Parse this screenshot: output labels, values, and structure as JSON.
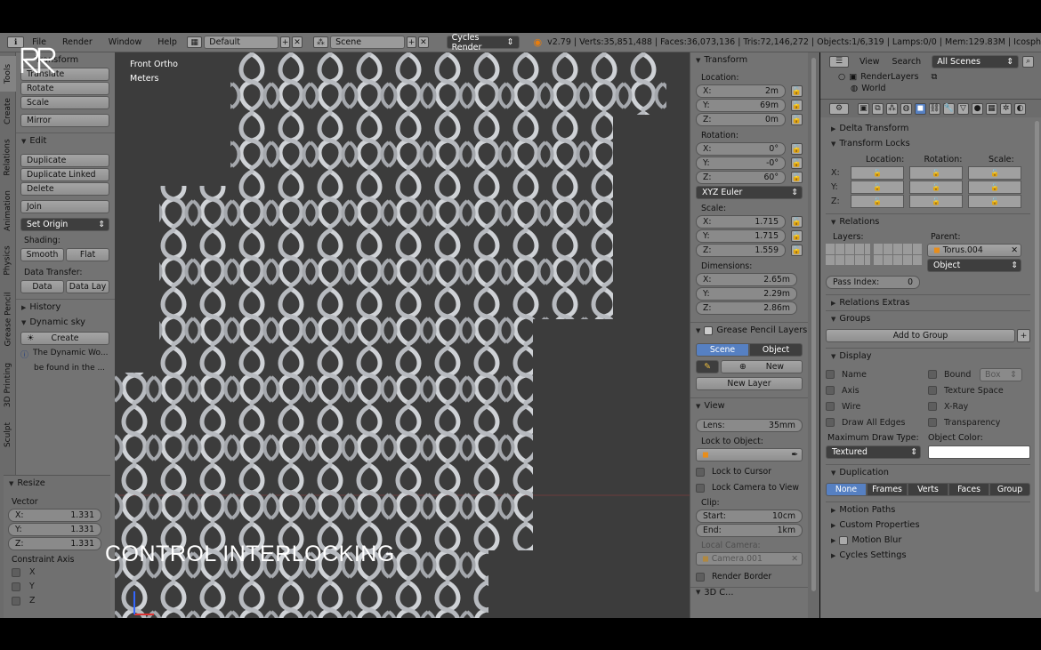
{
  "menu": {
    "file": "File",
    "render": "Render",
    "window": "Window",
    "help": "Help",
    "layout": "Default",
    "scene": "Scene",
    "engine": "Cycles Render"
  },
  "stats": "v2.79 | Verts:35,851,488 | Faces:36,073,136 | Tris:72,146,272 | Objects:1/6,319 | Lamps:0/0 | Mem:129.83M | Icosph",
  "tabs": [
    "Tools",
    "Create",
    "Relations",
    "Animation",
    "Physics",
    "Grease Pencil",
    "3D Printing",
    "Sculpt"
  ],
  "shelf": {
    "transform_title": "Transform",
    "translate": "Translate",
    "rotate": "Rotate",
    "scale": "Scale",
    "mirror": "Mirror",
    "edit_title": "Edit",
    "duplicate": "Duplicate",
    "duplicate_linked": "Duplicate Linked",
    "delete": "Delete",
    "join": "Join",
    "set_origin": "Set Origin",
    "shading_label": "Shading:",
    "smooth": "Smooth",
    "flat": "Flat",
    "data_transfer_label": "Data Transfer:",
    "data": "Data",
    "data_lay": "Data Lay",
    "history_title": "History",
    "dynamic_sky_title": "Dynamic sky",
    "create": "Create",
    "info_line1": "The Dynamic Wo...",
    "info_line2": "be found in the ...",
    "resize_title": "Resize",
    "vector_label": "Vector",
    "vx_label": "X:",
    "vx": "1.331",
    "vy_label": "Y:",
    "vy": "1.331",
    "vz_label": "Z:",
    "vz": "1.331",
    "constraint_label": "Constraint Axis",
    "cx": "X",
    "cy": "Y",
    "cz": "Z"
  },
  "viewport": {
    "view_name": "Front Ortho",
    "units": "Meters",
    "overlay": "CONTROL INTERLOCKING"
  },
  "npanel": {
    "transform_title": "Transform",
    "location_label": "Location:",
    "lx_label": "X:",
    "lx": "2m",
    "ly_label": "Y:",
    "ly": "69m",
    "lz_label": "Z:",
    "lz": "0m",
    "rotation_label": "Rotation:",
    "rx_label": "X:",
    "rx": "0°",
    "ry_label": "Y:",
    "ry": "-0°",
    "rz_label": "Z:",
    "rz": "60°",
    "euler": "XYZ Euler",
    "scale_label": "Scale:",
    "sx_label": "X:",
    "sx": "1.715",
    "sy_label": "Y:",
    "sy": "1.715",
    "sz_label": "Z:",
    "sz": "1.559",
    "dimensions_label": "Dimensions:",
    "dx_label": "X:",
    "dx": "2.65m",
    "dy_label": "Y:",
    "dy": "2.29m",
    "dz_label": "Z:",
    "dz": "2.86m",
    "gp_title": "Grease Pencil Layers",
    "scene_tab": "Scene",
    "object_tab": "Object",
    "new": "New",
    "new_layer": "New Layer",
    "view_title": "View",
    "lens_label": "Lens:",
    "lens": "35mm",
    "lock_object_label": "Lock to Object:",
    "lock_cursor": "Lock to Cursor",
    "lock_camera": "Lock Camera to View",
    "clip_label": "Clip:",
    "start_label": "Start:",
    "start": "10cm",
    "end_label": "End:",
    "end": "1km",
    "local_camera_label": "Local Camera:",
    "camera": "Camera.001",
    "render_border": "Render Border",
    "partial_title": "3D C..."
  },
  "outliner": {
    "view": "View",
    "search": "Search",
    "filter": "All Scenes",
    "item1": "RenderLayers",
    "item2": "World"
  },
  "props": {
    "delta_transform": "Delta Transform",
    "transform_locks": "Transform Locks",
    "loc_label": "Location:",
    "rot_label": "Rotation:",
    "scale_label": "Scale:",
    "x": "X:",
    "y": "Y:",
    "z": "Z:",
    "relations": "Relations",
    "layers_label": "Layers:",
    "parent_label": "Parent:",
    "parent": "Torus.004",
    "parent_type": "Object",
    "pass_index_label": "Pass Index:",
    "pass_index": "0",
    "relations_extras": "Relations Extras",
    "groups": "Groups",
    "add_to_group": "Add to Group",
    "display": "Display",
    "name": "Name",
    "axis": "Axis",
    "wire": "Wire",
    "draw_all_edges": "Draw All Edges",
    "bound": "Bound",
    "bound_type": "Box",
    "texture_space": "Texture Space",
    "xray": "X-Ray",
    "transparency": "Transparency",
    "max_draw_label": "Maximum Draw Type:",
    "object_color_label": "Object Color:",
    "draw_type": "Textured",
    "duplication": "Duplication",
    "dup_none": "None",
    "dup_frames": "Frames",
    "dup_verts": "Verts",
    "dup_faces": "Faces",
    "dup_group": "Group",
    "motion_paths": "Motion Paths",
    "custom_properties": "Custom Properties",
    "motion_blur": "Motion Blur",
    "cycles_settings": "Cycles Settings"
  }
}
